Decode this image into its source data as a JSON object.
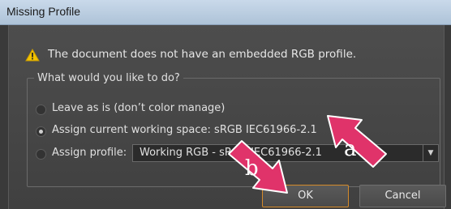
{
  "window": {
    "title": "Missing Profile"
  },
  "message": {
    "icon": "warning-icon",
    "text": "The document does not have an embedded RGB profile."
  },
  "group": {
    "legend": "What would you like to do?",
    "options": [
      {
        "label": "Leave as is (don’t color manage)",
        "selected": false
      },
      {
        "label": "Assign current working space: sRGB IEC61966-2.1",
        "selected": true
      },
      {
        "label": "Assign profile:",
        "selected": false
      }
    ],
    "profile_select": {
      "value": "Working RGB - sRGB IEC61966-2.1"
    }
  },
  "buttons": {
    "ok_label": "OK",
    "cancel_label": "Cancel"
  },
  "annotations": [
    {
      "label": "a",
      "color": "#e0336a"
    },
    {
      "label": "b",
      "color": "#e0336a"
    }
  ],
  "colors": {
    "titlebar": "#b8cbe0",
    "dialog_bg": "#474747",
    "ok_focus_border": "#d38a2a",
    "annotation_pink": "#e0336a"
  }
}
